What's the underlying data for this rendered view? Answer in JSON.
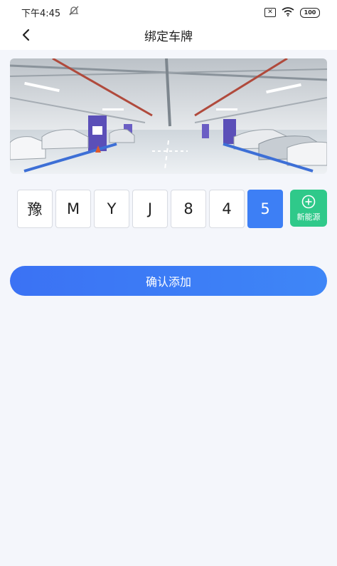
{
  "status_bar": {
    "time": "下午4:45",
    "dnd_icon": "bell-off-icon",
    "sim_icon": "sim-x-icon",
    "wifi_icon": "wifi-icon",
    "battery": "100"
  },
  "header": {
    "back_icon": "chevron-left-icon",
    "title": "绑定车牌"
  },
  "hero_image": {
    "description_icon": "parking-garage-photo"
  },
  "plate": {
    "chars": [
      "豫",
      "M",
      "Y",
      "J",
      "8",
      "4",
      "5"
    ],
    "active_index": 6
  },
  "new_energy": {
    "icon": "plus-circle-icon",
    "label": "新能源"
  },
  "confirm_button": {
    "label": "确认添加"
  },
  "colors": {
    "accent": "#3d7ff5",
    "new_energy": "#2fc98a",
    "background": "#f4f6fb"
  }
}
